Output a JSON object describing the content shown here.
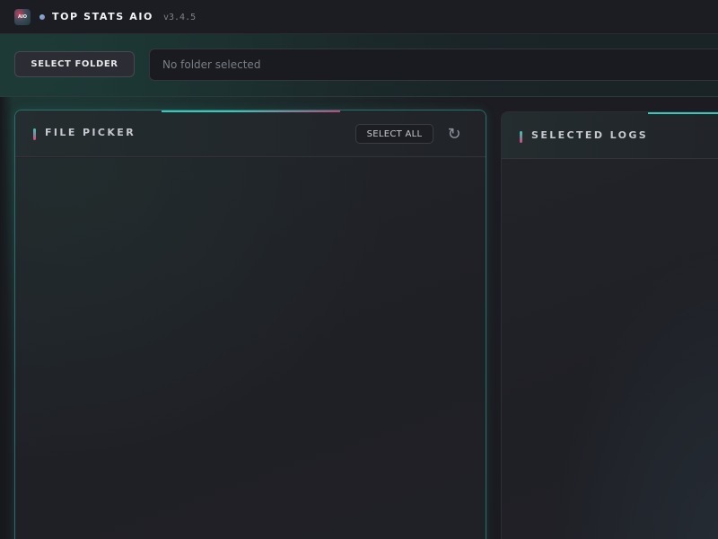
{
  "app": {
    "title": "TOP STATS AIO",
    "version": "v3.4.5",
    "logo_text": "AIO"
  },
  "toolbar": {
    "select_folder_label": "SELECT FOLDER",
    "folder_path_placeholder": "No folder selected"
  },
  "file_picker": {
    "title": "FILE PICKER",
    "select_all_label": "SELECT ALL",
    "refresh_icon": "refresh-icon"
  },
  "selected_logs": {
    "title": "SELECTED LOGS"
  },
  "colors": {
    "accent_teal": "#3ac7b8",
    "accent_pink": "#d24a7e",
    "panel_border_active": "#2b6e6a"
  }
}
